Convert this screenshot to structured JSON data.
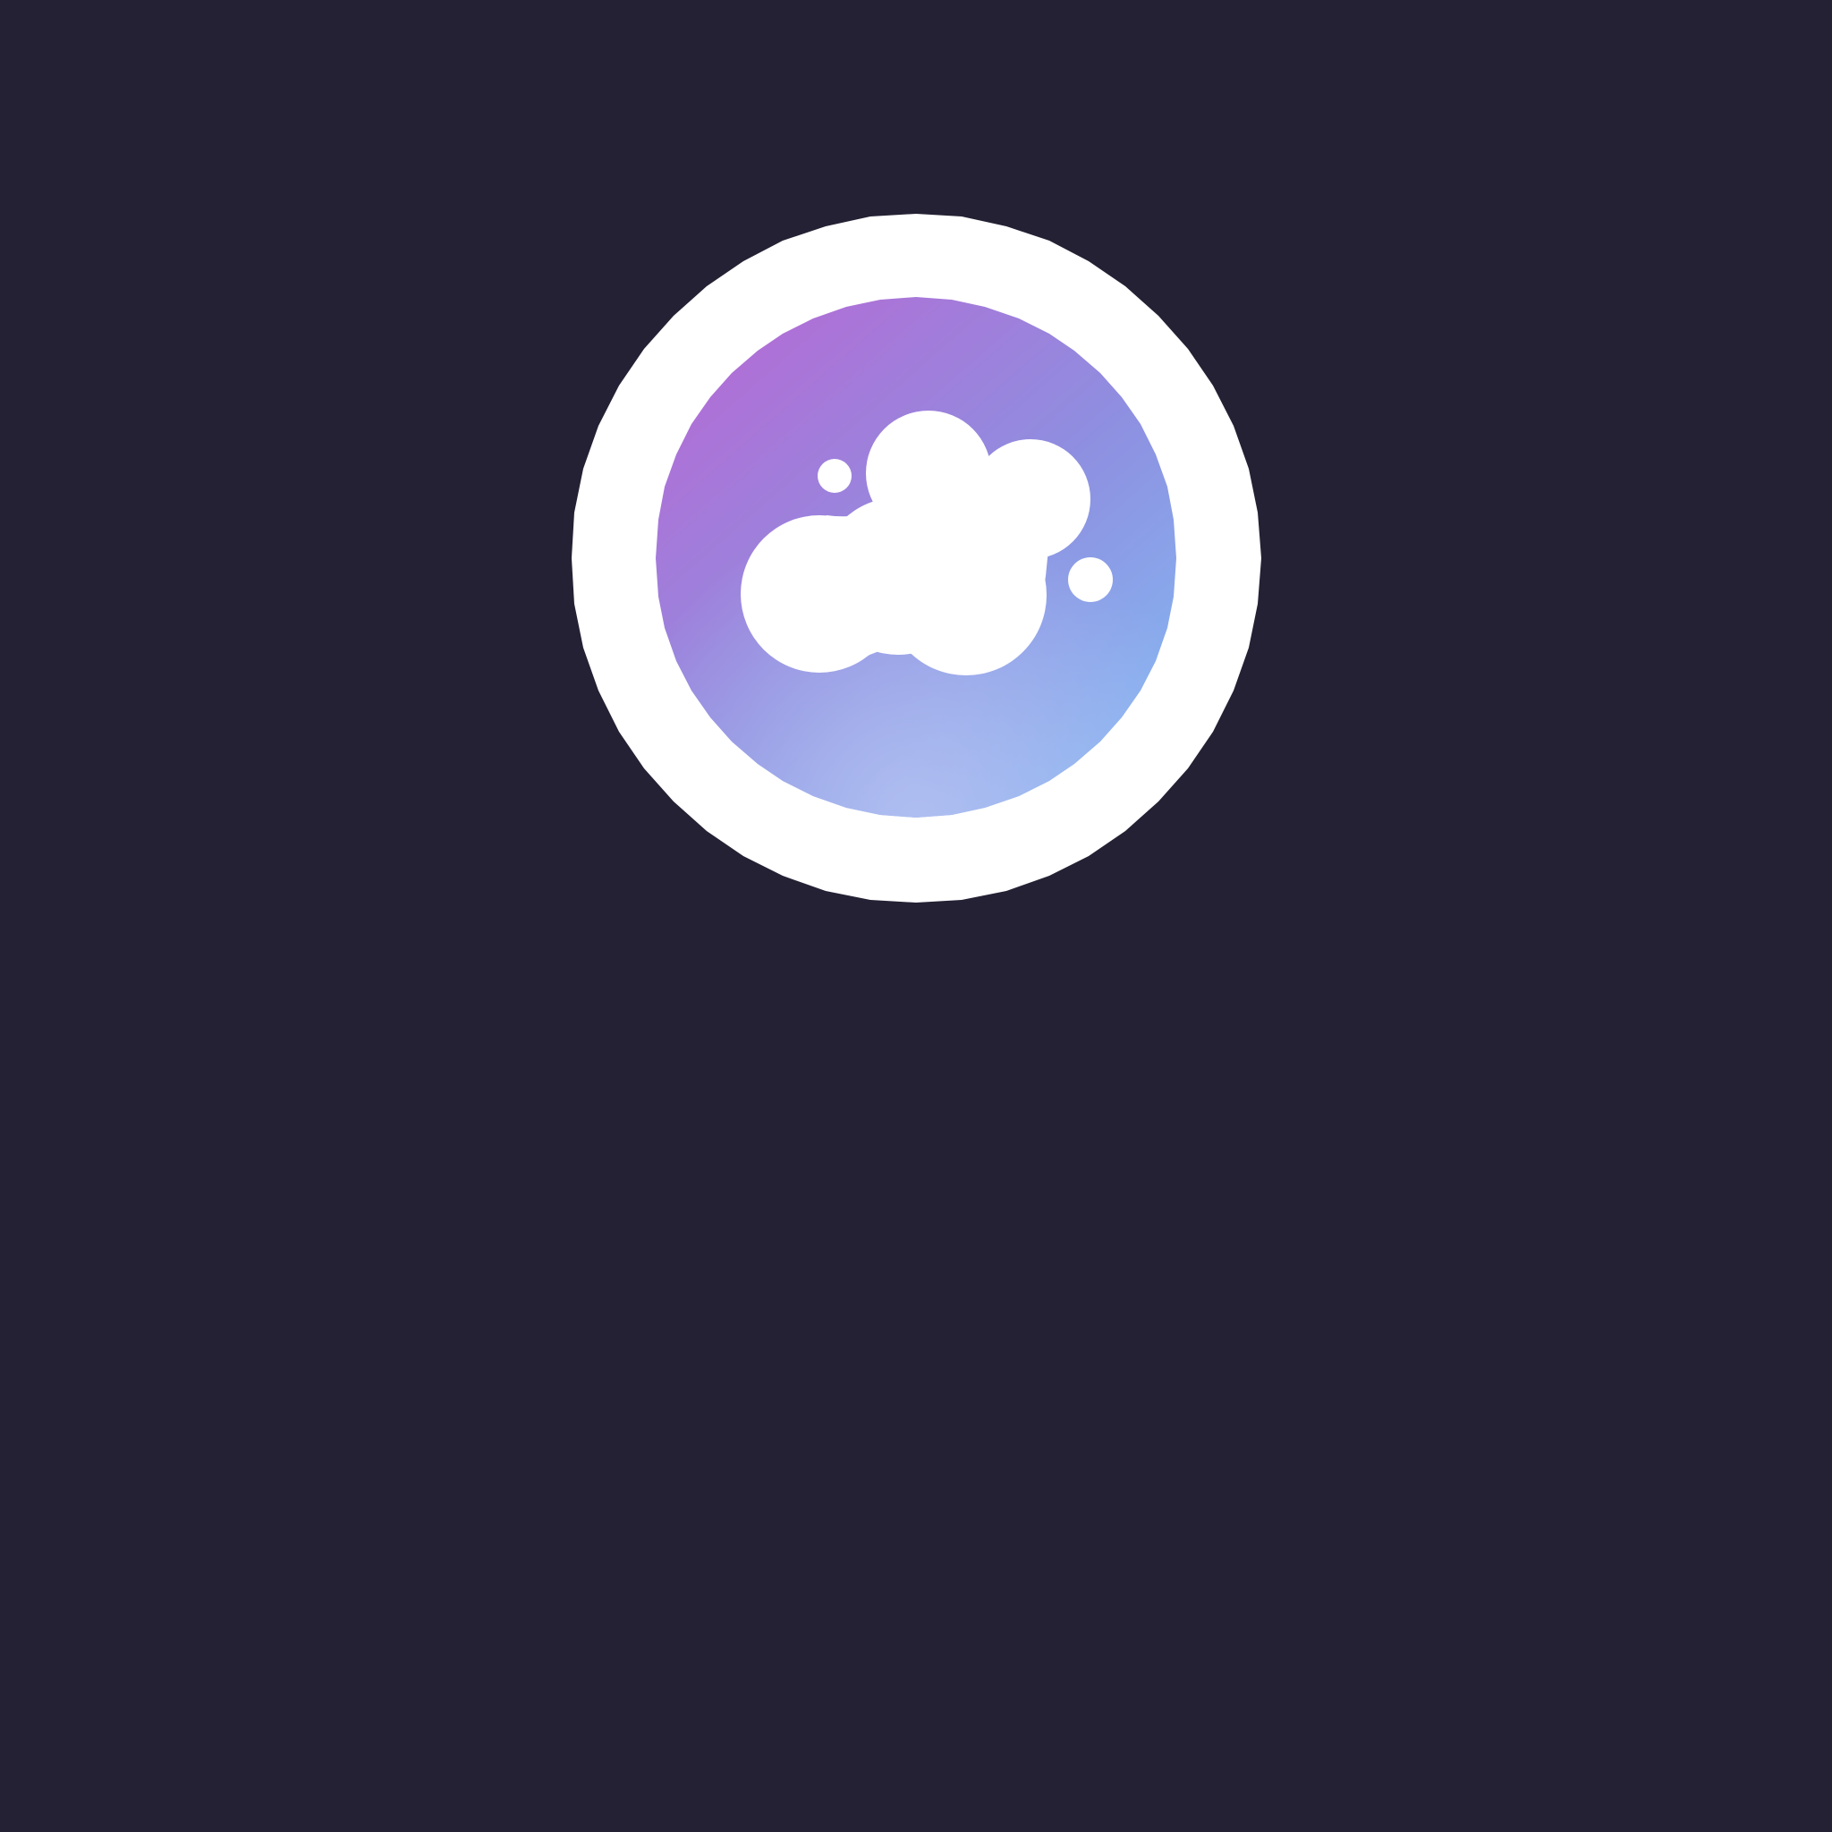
{
  "screen": {
    "background_color": "#252134"
  },
  "app_icon": {
    "icon": "cloud-bubbles-icon",
    "ring_color": "#ffffff",
    "gradient": {
      "top_left": "#b06fd6",
      "bottom_right": "#86b2f0",
      "bottom": "#a9b8ef"
    },
    "glyph_color": "#ffffff"
  }
}
